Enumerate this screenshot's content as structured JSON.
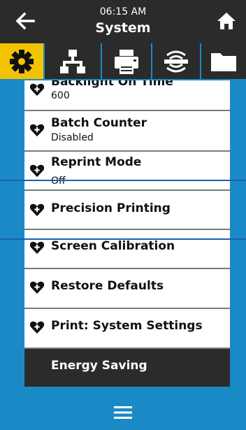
{
  "header": {
    "time": "06:15 AM",
    "title": "System",
    "back_icon": "arrow-left-icon",
    "home_icon": "home-icon"
  },
  "tabs": [
    {
      "icon": "gear-icon",
      "active": true
    },
    {
      "icon": "network-icon",
      "active": false
    },
    {
      "icon": "printer-icon",
      "active": false
    },
    {
      "icon": "rfid-icon",
      "active": false
    },
    {
      "icon": "folder-icon",
      "active": false
    }
  ],
  "menu": {
    "items": [
      {
        "label": "Backlight On Time",
        "value": "600"
      },
      {
        "label": "Batch Counter",
        "value": "Disabled"
      },
      {
        "label": "Reprint Mode",
        "value": "Off"
      },
      {
        "label": "Precision Printing"
      },
      {
        "label": "Screen Calibration"
      },
      {
        "label": "Restore Defaults"
      },
      {
        "label": "Print: System Settings"
      },
      {
        "label": "Energy Saving"
      }
    ]
  },
  "footer": {
    "menu_icon": "hamburger-menu-icon"
  },
  "colors": {
    "background": "#1a8ac6",
    "header": "#2b2b2b",
    "active_tab": "#f2c300",
    "divider_line": "#1a5fb4"
  }
}
